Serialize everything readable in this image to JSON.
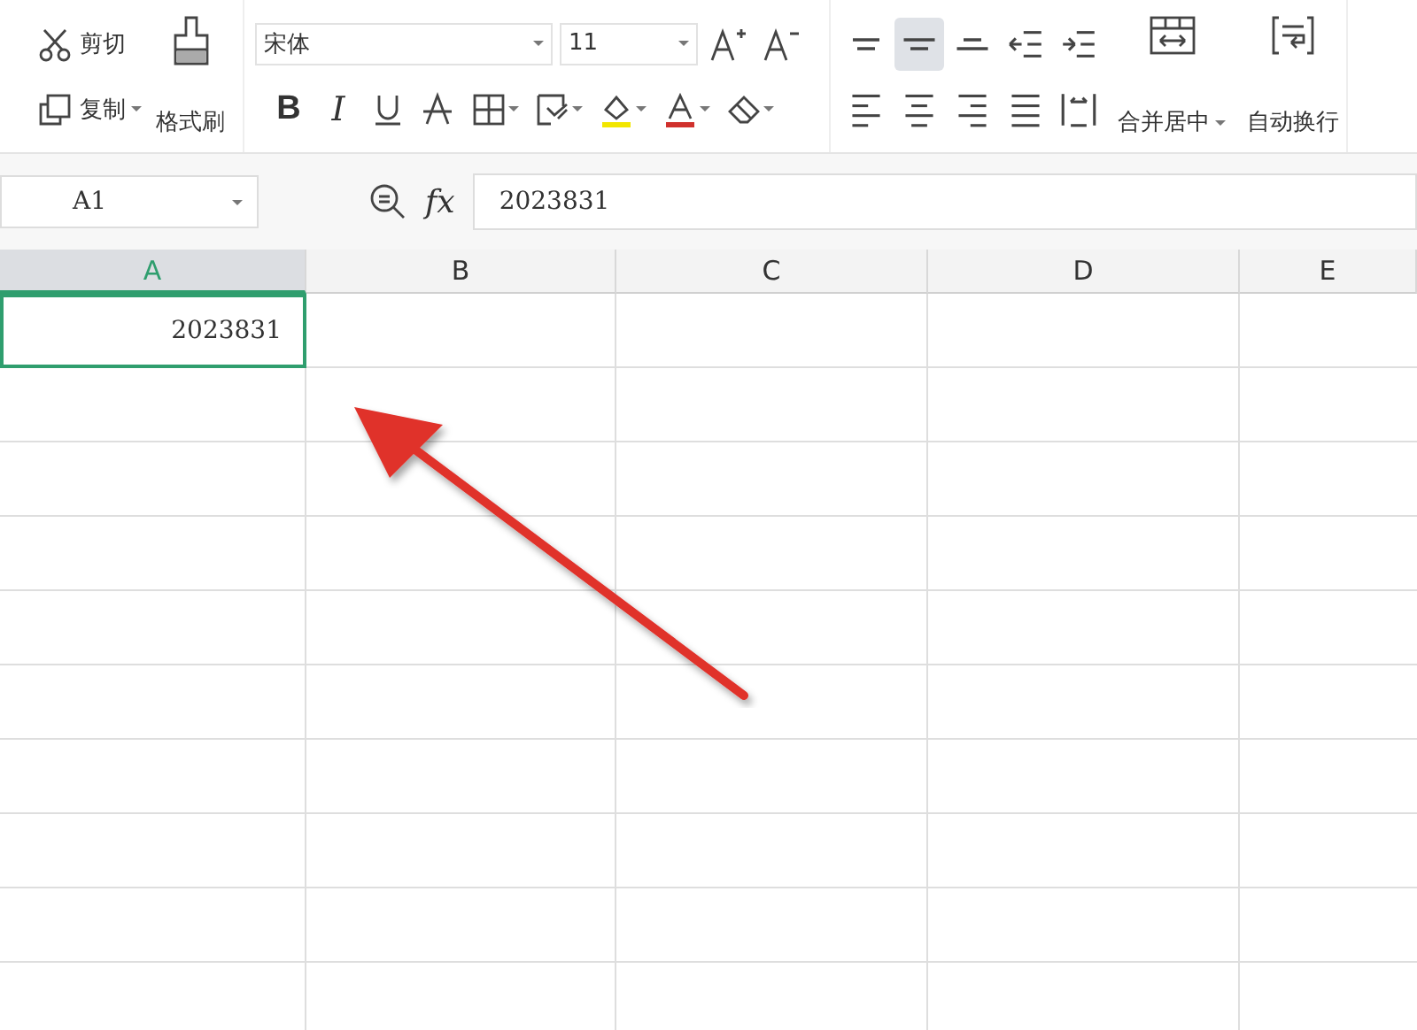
{
  "ribbon": {
    "clipboard": [
      {
        "kind": "cut",
        "label": "剪切"
      },
      {
        "kind": "copy",
        "label": "复制"
      }
    ],
    "format_painter": {
      "label": "格式刷"
    },
    "font": {
      "family": "宋体",
      "size": "11"
    },
    "font_size_buttons": [
      {
        "kind": "grow"
      },
      {
        "kind": "shrink"
      }
    ],
    "font_buttons": [
      {
        "kind": "bold",
        "label": "B"
      },
      {
        "kind": "italic",
        "label": "I"
      },
      {
        "kind": "underline"
      },
      {
        "kind": "strike"
      },
      {
        "kind": "border"
      },
      {
        "kind": "style"
      },
      {
        "kind": "fill",
        "color": "#f2e600"
      },
      {
        "kind": "fontcolor",
        "color": "#d0312d"
      },
      {
        "kind": "eraser"
      }
    ],
    "align_top": [
      {
        "kind": "top",
        "selected": false
      },
      {
        "kind": "middle",
        "selected": true
      },
      {
        "kind": "bottom",
        "selected": false
      },
      {
        "kind": "outdent",
        "selected": false
      },
      {
        "kind": "indent",
        "selected": false
      }
    ],
    "align_bottom": [
      {
        "kind": "left",
        "selected": false
      },
      {
        "kind": "center",
        "selected": false
      },
      {
        "kind": "right",
        "selected": false
      },
      {
        "kind": "justify",
        "selected": false
      },
      {
        "kind": "distribute",
        "selected": false
      }
    ],
    "merge": {
      "label": "合并居中"
    },
    "wrap": {
      "label": "自动换行"
    }
  },
  "formula_bar": {
    "name_box": "A1",
    "function_label": "fx",
    "formula": "2023831"
  },
  "sheet": {
    "columns": [
      {
        "label": "A",
        "selected": true
      },
      {
        "label": "B",
        "selected": false
      },
      {
        "label": "C",
        "selected": false
      },
      {
        "label": "D",
        "selected": false
      },
      {
        "label": "E",
        "selected": false
      }
    ],
    "rows": [
      {
        "cells": [
          {
            "value": "2023831",
            "selected": true
          }
        ]
      }
    ]
  }
}
